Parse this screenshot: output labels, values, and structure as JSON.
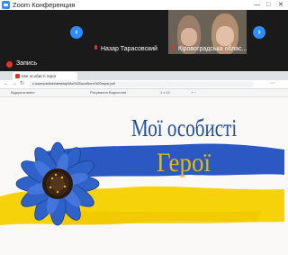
{
  "window": {
    "title": "Zoom Конференция",
    "minimize": "—",
    "maximize": "□",
    "close": "✕"
  },
  "gallery": {
    "prev_arrow": "‹",
    "next_arrow": "›",
    "participants": [
      {
        "name": "Назар Тарасовский",
        "muted": true
      },
      {
        "name": "Кіровоградська облас...",
        "muted": true
      }
    ]
  },
  "recording": {
    "label": "Запись"
  },
  "browser": {
    "tab_title": "Мої особисті герої",
    "url": "c:/users/admin/desktop/Мої%20особисті%20герої.pdf",
    "pdf_toolbar": {
      "left": "Відкрити вміст",
      "center": "Рисування  Виділення",
      "page": "1  з 12",
      "zoom": "+  −"
    }
  },
  "slide": {
    "heading_line1": "Мої особисті",
    "heading_line2": "Герої",
    "colors": {
      "blue": "#2b59c3",
      "yellow": "#f5d20a",
      "heading_blue": "#1f4e9c",
      "heading_yellow": "#e3b90b"
    },
    "image": "sunflower-illustration"
  }
}
